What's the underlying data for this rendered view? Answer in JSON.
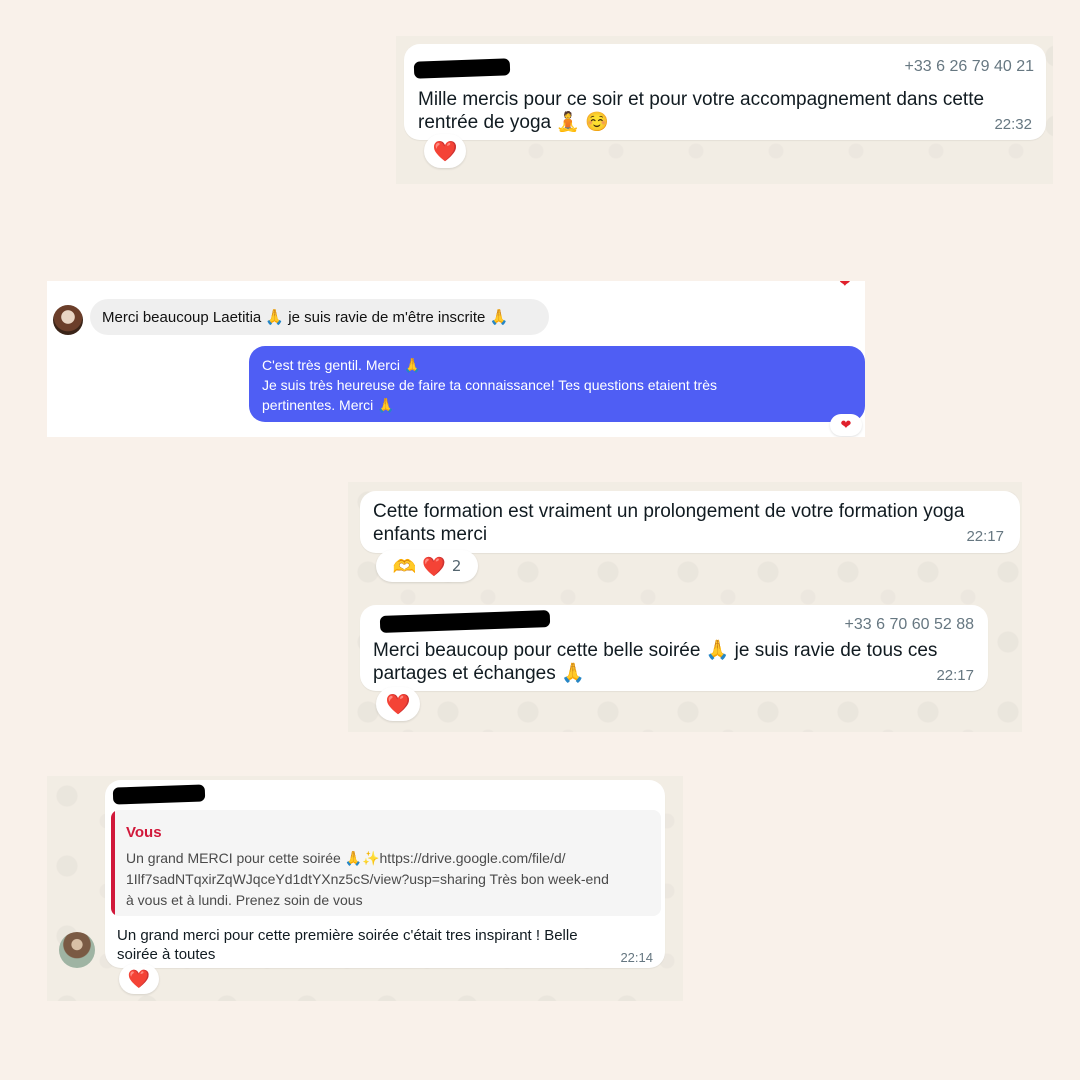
{
  "msg1": {
    "phone": "+33 6 26 79 40 21",
    "text": "Mille mercis pour ce soir et pour votre accompagnement dans cette\nrentrée de yoga 🧘 ☺️",
    "time": "22:32",
    "reaction": "❤️"
  },
  "ig": {
    "reaction_top": "❤",
    "incoming_text": "Merci beaucoup Laetitia 🙏 je suis ravie de m'être inscrite 🙏",
    "outgoing_text": "C'est très gentil. Merci 🙏\nJe suis très heureuse de faire ta connaissance! Tes questions etaient très\npertinentes. Merci 🙏",
    "reaction_bottom": "❤",
    "colors": {
      "outgoing_bubble": "#4f5ef4",
      "incoming_bubble": "#efefef"
    }
  },
  "msg2": {
    "text": "Cette formation est vraiment un prolongement de votre formation yoga\nenfants merci",
    "time": "22:17",
    "reaction_emojis": "🫶 ❤️",
    "reaction_count": "2"
  },
  "msg3": {
    "phone": "+33 6 70 60 52 88",
    "text": "Merci beaucoup pour cette belle soirée 🙏 je suis ravie de tous ces\npartages et échanges 🙏",
    "time": "22:17",
    "reaction": "❤️"
  },
  "msg4": {
    "quote_author": "Vous",
    "quote_text": "Un grand MERCI pour cette soirée 🙏✨https://drive.google.com/file/d/\n1Ilf7sadNTqxirZqWJqceYd1dtYXnz5cS/view?usp=sharing Très bon week-end\nà vous et à lundi. Prenez soin de vous",
    "text": "Un grand merci pour cette première soirée c'était tres inspirant ! Belle\nsoirée à toutes",
    "time": "22:14",
    "reaction": "❤️",
    "colors": {
      "quote_accent": "#d1183a"
    }
  }
}
